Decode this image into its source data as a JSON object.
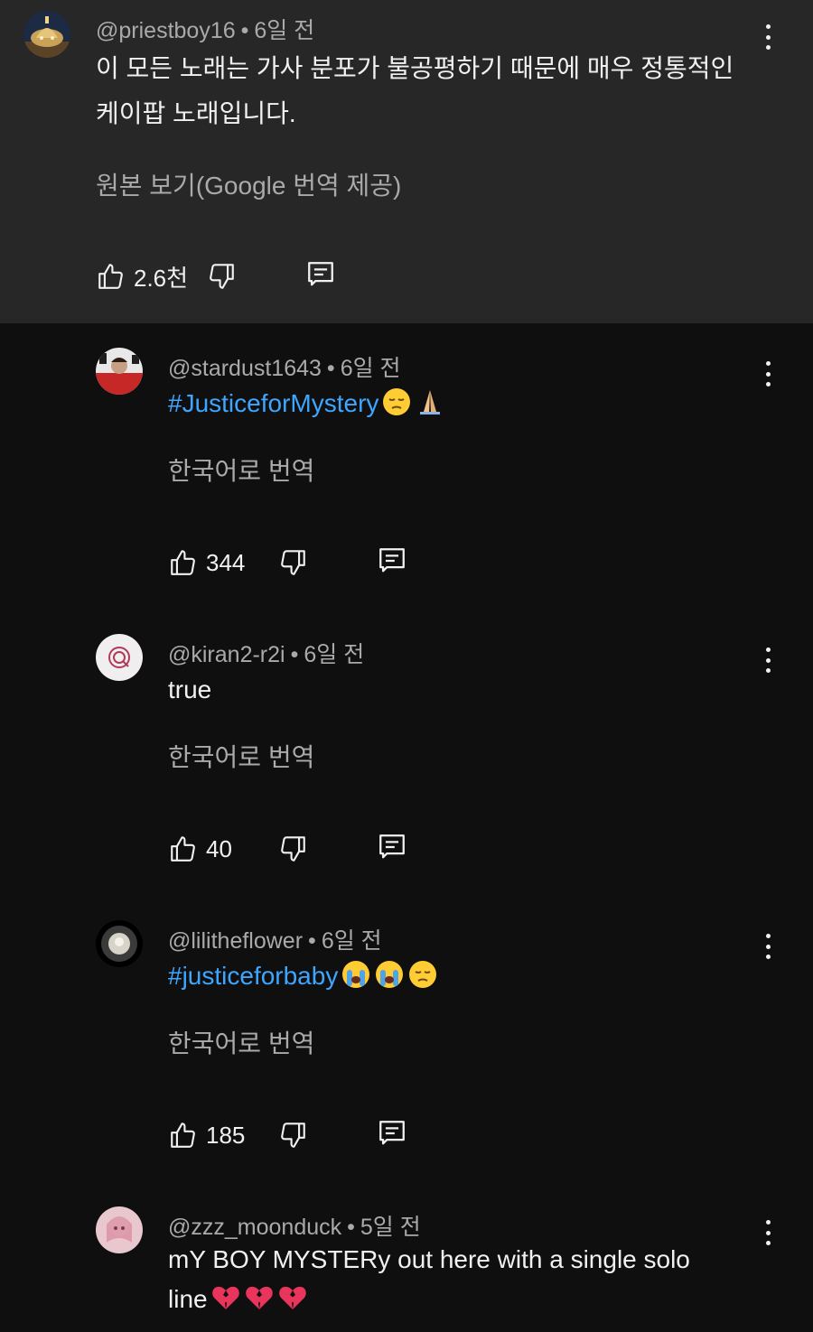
{
  "comments": [
    {
      "author": "@priestboy16",
      "time": "6일 전",
      "text_line1": "이 모든 노래는 가사 분포가 불공평하기 때문에 매우 정통적인",
      "text_line2": "케이팝 노래입니다.",
      "translate": "원본 보기(Google 번역 제공)",
      "likes": "2.6천"
    },
    {
      "author": "@stardust1643",
      "time": "6일 전",
      "hashtag": "#JusticeforMystery",
      "emojis": [
        "pensive-face",
        "folded-hands"
      ],
      "translate": "한국어로 번역",
      "likes": "344"
    },
    {
      "author": "@kiran2-r2i",
      "time": "6일 전",
      "text": "true",
      "translate": "한국어로 번역",
      "likes": "40"
    },
    {
      "author": "@lilitheflower",
      "time": "6일 전",
      "hashtag": "#justiceforbaby",
      "emojis": [
        "loudly-crying-face",
        "loudly-crying-face",
        "pensive-face"
      ],
      "translate": "한국어로 번역",
      "likes": "185"
    },
    {
      "author": "@zzz_moonduck",
      "time": "5일 전",
      "text_line1": "mY BOY MYSTERy out here with a single solo",
      "text_line2": "line",
      "emojis": [
        "broken-heart",
        "broken-heart",
        "broken-heart"
      ]
    }
  ],
  "separator": "•",
  "colors": {
    "background": "#0f0f0f",
    "highlighted_background": "#272727",
    "hashtag": "#3ea6ff",
    "secondary_text": "#aaaaaa"
  }
}
